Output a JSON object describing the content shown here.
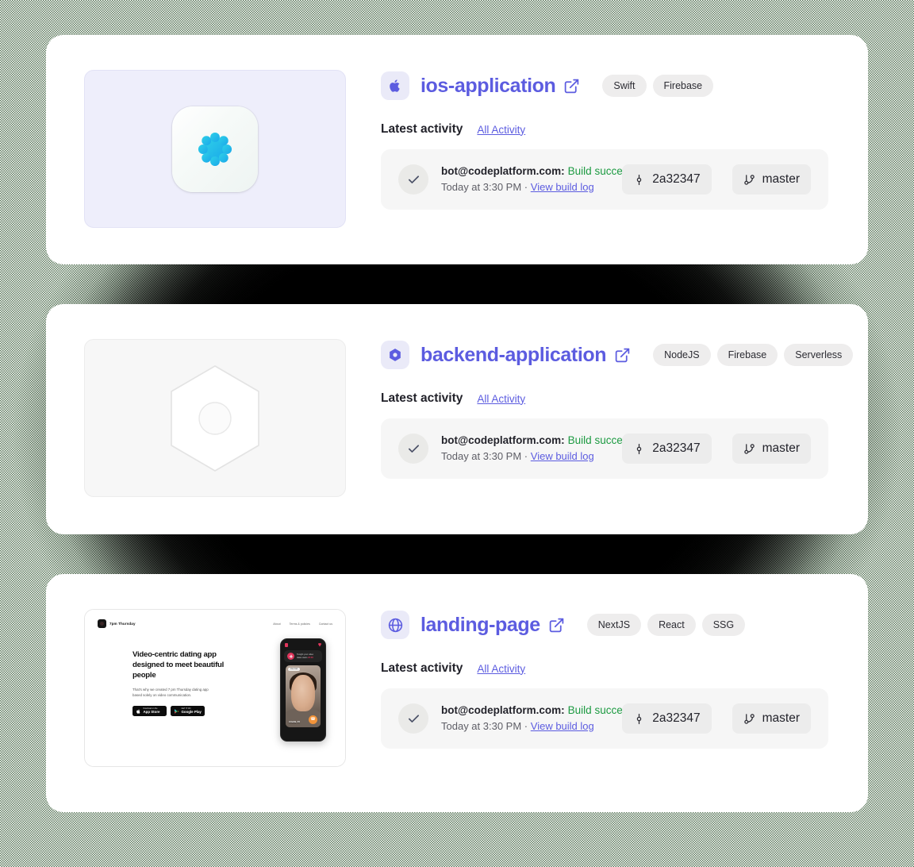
{
  "page": {
    "background_color": "#0a0a0a",
    "card_background": "#ffffff",
    "accent_color": "#5c5ce0",
    "success_color": "#1c9a41"
  },
  "projects": [
    {
      "id": "ios-application",
      "name": "ios-application",
      "icon": "apple-icon",
      "external_link_icon": "external-link-icon",
      "thumbnail": {
        "kind": "app-icon",
        "icon_name": "scalloped-flower-app-icon",
        "background_color": "#eeeefb",
        "glyph_color": "#22bde6"
      },
      "tags": [
        "Swift",
        "Firebase"
      ],
      "activity_label": "Latest activity",
      "all_activity_label": "All Activity",
      "activity": {
        "status_icon": "check-icon",
        "author": "bot@codeplatform.com:",
        "status": "Build succeeded",
        "timestamp": "Today at 3:30 PM",
        "separator": "·",
        "log_link": "View build log",
        "commit_icon": "git-commit-icon",
        "commit": "2a32347",
        "branch_icon": "git-branch-icon",
        "branch": "master"
      }
    },
    {
      "id": "backend-application",
      "name": "backend-application",
      "icon": "hexagon-core-icon",
      "external_link_icon": "external-link-icon",
      "thumbnail": {
        "kind": "placeholder",
        "icon_name": "hexagon-placeholder-icon",
        "background_color": "#f7f7f7",
        "glyph_color": "#ffffff"
      },
      "tags": [
        "NodeJS",
        "Firebase",
        "Serverless"
      ],
      "activity_label": "Latest activity",
      "all_activity_label": "All Activity",
      "activity": {
        "status_icon": "check-icon",
        "author": "bot@codeplatform.com:",
        "status": "Build succeeded",
        "timestamp": "Today at 3:30 PM",
        "separator": "·",
        "log_link": "View build log",
        "commit_icon": "git-commit-icon",
        "commit": "2a32347",
        "branch_icon": "git-branch-icon",
        "branch": "master"
      }
    },
    {
      "id": "landing-page",
      "name": "landing-page",
      "icon": "globe-icon",
      "external_link_icon": "external-link-icon",
      "thumbnail": {
        "kind": "website-preview",
        "background_color": "#ffffff",
        "site": {
          "brand": "7pm Thursday",
          "nav": [
            "About",
            "Terms & policies",
            "Contact us"
          ],
          "headline": "Video-centric dating app designed to meet beautiful people",
          "subtext": "That's why we created 7 pm Thursday dating app based solely on video communication.",
          "store_badges": [
            {
              "small": "Download on the",
              "large": "App Store",
              "icon": "apple-icon"
            },
            {
              "small": "GET IT ON",
              "large": "Google Play",
              "icon": "play-store-icon"
            }
          ],
          "phone": {
            "banner_text": "Tonight your video dates starts",
            "banner_highlight": "20:00",
            "card_tag": "Live now",
            "profile_name": "Amelia, 24",
            "call_icon": "phone-icon"
          }
        }
      },
      "tags": [
        "NextJS",
        "React",
        "SSG"
      ],
      "activity_label": "Latest activity",
      "all_activity_label": "All Activity",
      "activity": {
        "status_icon": "check-icon",
        "author": "bot@codeplatform.com:",
        "status": "Build succeeded",
        "timestamp": "Today at 3:30 PM",
        "separator": "·",
        "log_link": "View build log",
        "commit_icon": "git-commit-icon",
        "commit": "2a32347",
        "branch_icon": "git-branch-icon",
        "branch": "master"
      }
    }
  ]
}
